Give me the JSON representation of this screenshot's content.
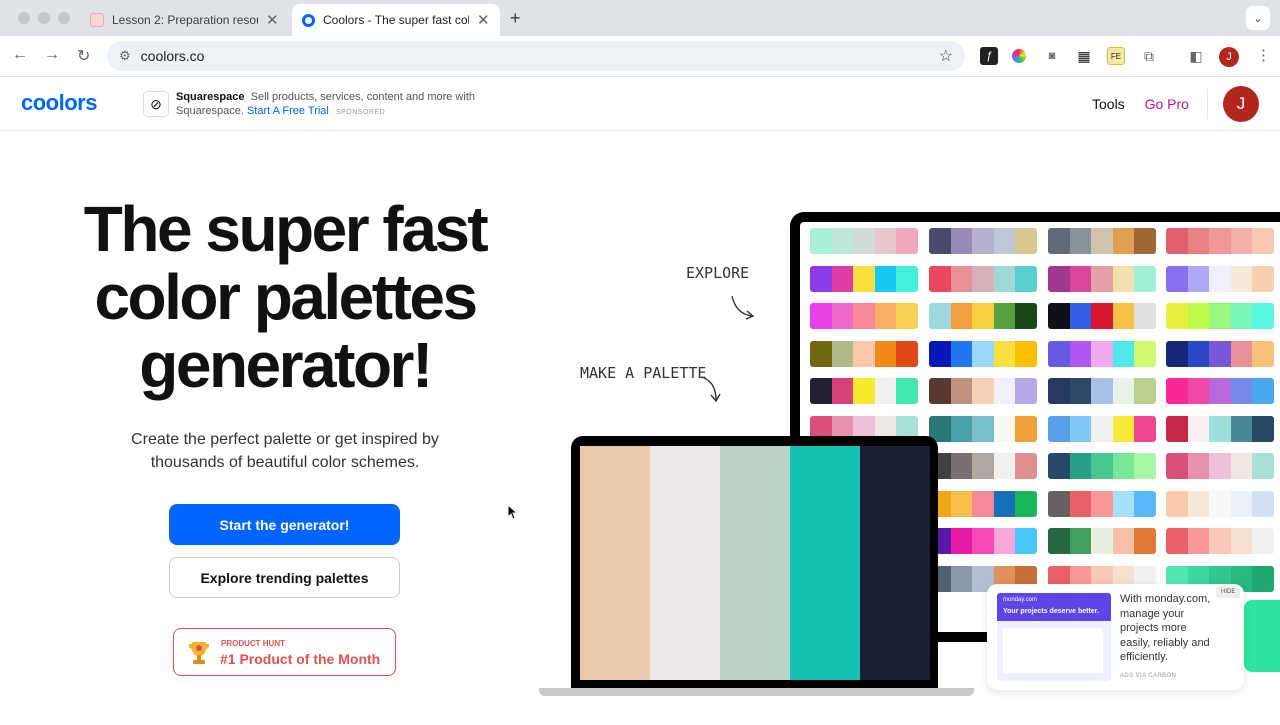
{
  "browser": {
    "tabs": [
      {
        "title": "Lesson 2: Preparation resourc",
        "active": false
      },
      {
        "title": "Coolors - The super fast colo",
        "active": true
      }
    ],
    "url": "coolors.co",
    "profile_initial": "J"
  },
  "header": {
    "logo": "coolors",
    "ad": {
      "brand": "Squarespace",
      "text": "Sell products, services, content and more with Squarespace.",
      "link": "Start A Free Trial",
      "sponsored": "SPONSORED"
    },
    "nav": {
      "tools": "Tools",
      "gopro": "Go Pro"
    },
    "avatar_initial": "J"
  },
  "hero": {
    "line1": "The super fast",
    "line2": "color palettes",
    "line3": "generator!",
    "sub1": "Create the perfect palette or get inspired by",
    "sub2": "thousands of beautiful color schemes.",
    "start_button": "Start the generator!",
    "explore_button": "Explore trending palettes",
    "product_hunt": {
      "label": "PRODUCT HUNT",
      "title": "#1 Product of the Month"
    }
  },
  "illustration": {
    "explore": "EXPLORE",
    "make": "MAKE A PALETTE",
    "laptop_palette": [
      "#ecc9a9",
      "#eee8e8",
      "#bcd2c6",
      "#15c2b2",
      "#172133"
    ],
    "monitor_palettes": [
      [
        [
          "#a8f0d8",
          "#c0e8d8",
          "#d0dcd8",
          "#e8c4cc",
          "#f0a8bc"
        ],
        [
          "#4a4a6a",
          "#9a8ab8",
          "#b8b0d0",
          "#c0c8d8",
          "#d8c890"
        ],
        [
          "#606a78",
          "#8a9098",
          "#d0c4b0",
          "#e0a050",
          "#a06838"
        ],
        [
          "#e06070",
          "#e88080",
          "#f09898",
          "#f4b0a8",
          "#f8c8b0"
        ]
      ],
      [
        [
          "#8a3ce8",
          "#e03ca8",
          "#f8e040",
          "#18c8f0",
          "#40f0d8"
        ],
        [
          "#e84860",
          "#e89098",
          "#d8b0b8",
          "#a0d8d8",
          "#58d0d0"
        ],
        [
          "#a03890",
          "#d84898",
          "#e8a0a8",
          "#f0e0b0",
          "#a0f0d8"
        ],
        [
          "#8a70f0",
          "#b0a8f8",
          "#f0f0f8",
          "#f8e8d8",
          "#f8d0b0"
        ]
      ],
      [
        [
          "#e840e8",
          "#f068c8",
          "#f88898",
          "#f8b068",
          "#f8d058"
        ],
        [
          "#a0d8e0",
          "#f0a040",
          "#f8d040",
          "#58a040",
          "#184818"
        ],
        [
          "#101018",
          "#3060e8",
          "#d81830",
          "#f8c040",
          "#e0e0e0"
        ],
        [
          "#e8f040",
          "#c0f848",
          "#98f880",
          "#78f8b8",
          "#58f8e0"
        ]
      ],
      [
        [
          "#706810",
          "#b0b888",
          "#f8c8a8",
          "#f08818",
          "#e04818"
        ],
        [
          "#0818b8",
          "#2078f0",
          "#98d8f8",
          "#f8e040",
          "#f8c000"
        ],
        [
          "#6858e8",
          "#b058f0",
          "#f0a8f0",
          "#50e8e8",
          "#d0f870"
        ],
        [
          "#182878",
          "#2848c8",
          "#7858d8",
          "#e89098",
          "#f8c078"
        ]
      ],
      [
        [
          "#202030",
          "#d8407a",
          "#f8e830",
          "#f0f0f0",
          "#40e8b0"
        ],
        [
          "#583830",
          "#c09080",
          "#f8d0b8",
          "#f0f0f8",
          "#b8a8e8"
        ],
        [
          "#283860",
          "#304868",
          "#a8c0e8",
          "#e8f0e8",
          "#b8d090"
        ],
        [
          "#f82898",
          "#f048a8",
          "#b868d8",
          "#7888e8",
          "#48a8f0"
        ]
      ],
      [
        [
          "#d85078",
          "#e890b0",
          "#f0c0d8",
          "#f0e8e0",
          "#a8e0d8"
        ],
        [
          "#287878",
          "#48a0a8",
          "#78c0c8",
          "#f8f8f0",
          "#f0a038"
        ],
        [
          "#58a0e8",
          "#80c8f8",
          "#f0f0f0",
          "#f8e838",
          "#f04890"
        ],
        [
          "#c82848",
          "#f8f0f0",
          "#98e0d8",
          "#488898",
          "#284868"
        ]
      ],
      [
        [
          "#203838",
          "#185030",
          "#d06098",
          "#f0a8c8",
          "#f8d828"
        ],
        [
          "#404040",
          "#787070",
          "#b0a8a0",
          "#f0f0f0",
          "#e09090"
        ],
        [
          "#284868",
          "#28a088",
          "#48c890",
          "#78e898",
          "#a8f8a8"
        ],
        [
          "#d85078",
          "#e890b0",
          "#f0c0d8",
          "#f0e8e0",
          "#a8e0d8"
        ]
      ],
      [
        [
          "#183848",
          "#e81818",
          "#f87818",
          "#f8c818",
          "#f8e898"
        ],
        [
          "#f0a818",
          "#f8c048",
          "#f88898",
          "#1870b8",
          "#18b858"
        ],
        [
          "#686060",
          "#e86068",
          "#f89898",
          "#a8e0f8",
          "#58b8f8"
        ],
        [
          "#f8c8a8",
          "#f8e8d8",
          "#f8f8f8",
          "#e8f0f8",
          "#d0e0f0"
        ]
      ],
      [
        [
          "#18b0a0",
          "#f8e8d8",
          "#f8d018",
          "#e84818",
          "#e81848"
        ],
        [
          "#5818a8",
          "#e818a8",
          "#f848b8",
          "#f8a8d8",
          "#48c8f8"
        ],
        [
          "#286840",
          "#40a060",
          "#e8f0e0",
          "#f8c0a8",
          "#e07838"
        ],
        [
          "#e86068",
          "#f89898",
          "#f8c8b8",
          "#f8e0d0",
          "#f0f0f0"
        ]
      ],
      [
        [
          "#8888b8",
          "#a898c8",
          "#d8d0e0",
          "#f0f0f0",
          "#e8d8a8"
        ],
        [
          "#506070",
          "#8898a8",
          "#b0c0d0",
          "#e09058",
          "#c87038"
        ],
        [
          "#e86068",
          "#f89898",
          "#f8c8b8",
          "#f8e0d0",
          "#f0f0f0"
        ],
        [
          "#50e8b0",
          "#38d8a0",
          "#30c890",
          "#28b880",
          "#20a870"
        ]
      ]
    ],
    "carbon": {
      "brand_small": "monday.com",
      "headline": "Your projects deserve better.",
      "text": "With monday.com, manage your projects more easily, reliably and efficiently.",
      "hide": "HIDE",
      "via": "ADS VIA CARBON"
    }
  }
}
